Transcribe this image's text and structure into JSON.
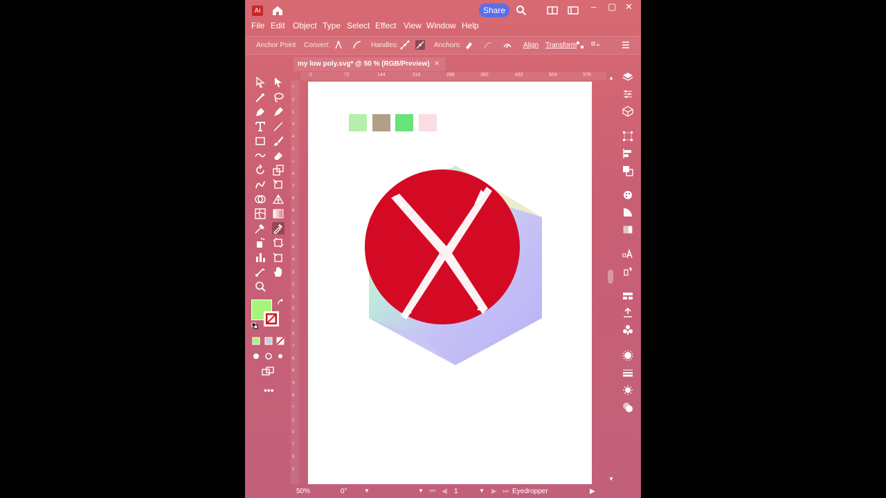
{
  "app": {
    "logo_text": "Ai",
    "share_label": "Share",
    "accent": "#5b6ee8"
  },
  "menu": [
    "File",
    "Edit",
    "Object",
    "Type",
    "Select",
    "Effect",
    "View",
    "Window",
    "Help"
  ],
  "control_bar": {
    "mode_label": "Anchor Point",
    "convert_label": "Convert:",
    "handles_label": "Handles:",
    "anchors_label": "Anchors:",
    "align_label": "Align",
    "transform_label": "Transform"
  },
  "document": {
    "tab_title": "my low poly.svg* @ 50 % (RGB/Preview)",
    "close_icon": "×"
  },
  "ruler_top": [
    "0",
    "72",
    "144",
    "216",
    "288",
    "360",
    "432",
    "504",
    "576"
  ],
  "ruler_left": [
    "7",
    "2",
    "1",
    "4",
    "4",
    "2",
    "1",
    "6",
    "2",
    "8",
    "8",
    "3",
    "6",
    "0",
    "4",
    "3",
    "2",
    "5",
    "0",
    "4",
    "5",
    "7",
    "6",
    "6",
    "4",
    "8",
    "7",
    "2",
    "0",
    "7",
    "9",
    "2"
  ],
  "swatches": [
    "#b6eeab",
    "#b1a087",
    "#6ae27a",
    "#fbdde3"
  ],
  "colors": {
    "fill": "#a6f47e",
    "circle": "#d40a24",
    "hexagon": "#b8b1f6"
  },
  "status": {
    "zoom": "50%",
    "rotation": "0°",
    "artboard": "1",
    "tool_name": "Eyedropper"
  }
}
